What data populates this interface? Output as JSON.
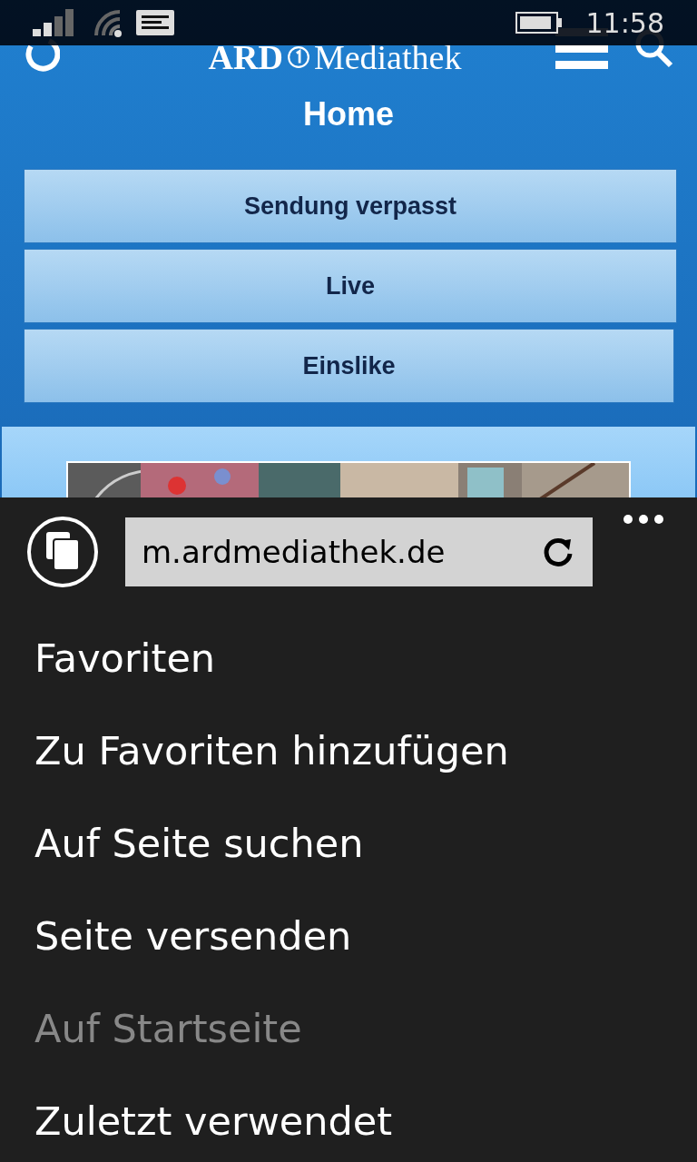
{
  "status_bar": {
    "time": "11:58"
  },
  "site": {
    "logo_left": "ARD",
    "logo_right": "Mediathek",
    "title": "Home",
    "nav_buttons": [
      {
        "label": "Sendung verpasst"
      },
      {
        "label": "Live"
      },
      {
        "label": "Einslike"
      }
    ]
  },
  "browser_bar": {
    "address": "m.ardmediathek.de"
  },
  "menu": [
    {
      "label": "Favoriten",
      "disabled": false
    },
    {
      "label": "Zu Favoriten hinzufügen",
      "disabled": false
    },
    {
      "label": "Auf Seite suchen",
      "disabled": false
    },
    {
      "label": "Seite versenden",
      "disabled": false
    },
    {
      "label": "Auf Startseite",
      "disabled": true
    },
    {
      "label": "Zuletzt verwendet",
      "disabled": false
    }
  ]
}
